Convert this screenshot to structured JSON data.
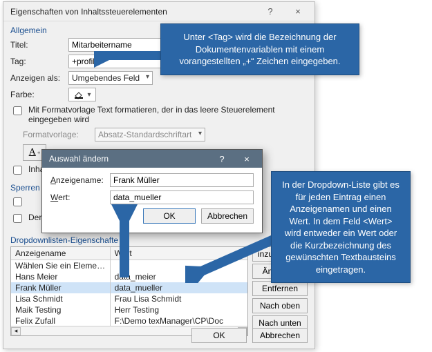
{
  "dialog": {
    "title": "Eigenschaften von Inhaltssteuerelementen",
    "help_icon": "?",
    "close_icon": "×",
    "section_general": "Allgemein",
    "titel_label": "Titel:",
    "titel_value": "Mitarbeitername",
    "tag_label": "Tag:",
    "tag_value": "+profile",
    "anzeigen_label": "Anzeigen als:",
    "anzeigen_value": "Umgebendes Feld",
    "farbe_label": "Farbe:",
    "chk_format_label": "Mit Formatvorlage Text formatieren, der in das leere Steuerelement eingegeben wird",
    "formatvorlage_label": "Formatvorlage:",
    "formatvorlage_value": "Absatz-Standardschriftart",
    "neue_formatvorlage_btn": "A",
    "chk_inhalt_label": "Inhalt",
    "sperren_label": "Sperren",
    "chk_sperren1": "",
    "chk_der_label": "Der I",
    "dd_section": "Dropdownlisten-Eigenschafte",
    "dd_col_name": "Anzeigename",
    "dd_col_value": "Wert",
    "dd_rows": [
      {
        "name": "Wählen Sie ein Element aus.",
        "value": ""
      },
      {
        "name": "Hans Meier",
        "value": "data_meier"
      },
      {
        "name": "Frank Müller",
        "value": "data_mueller"
      },
      {
        "name": "Lisa Schmidt",
        "value": "Frau Lisa Schmidt"
      },
      {
        "name": "Maik Testing",
        "value": "Herr Testing"
      },
      {
        "name": "Felix Zufall",
        "value": "F:\\Demo texManager\\CP\\Doc"
      }
    ],
    "side_buttons": {
      "add": "inzufügen…",
      "edit": "Ändern…",
      "remove": "Entfernen",
      "up": "Nach oben",
      "down": "Nach unten"
    },
    "ok": "OK",
    "cancel": "Abbrechen"
  },
  "modal": {
    "title": "Auswahl ändern",
    "help_icon": "?",
    "close_icon": "×",
    "anzeigename_label": "Anzeigename:",
    "anzeigename_value": "Frank Müller",
    "wert_label": "Wert:",
    "wert_value": "data_mueller",
    "ok": "OK",
    "cancel": "Abbrechen"
  },
  "callouts": {
    "c1": "Unter <Tag> wird die Bezeichnung der Dokumentenvariablen mit einem vorangestellten „+“ Zeichen eingegeben.",
    "c2": "In der Dropdown-Liste gibt es für jeden Eintrag einen Anzeigenamen und einen Wert. In dem Feld <Wert> wird entweder ein Wert oder die Kurzbezeichnung des gewünschten Textbausteins eingetragen."
  }
}
